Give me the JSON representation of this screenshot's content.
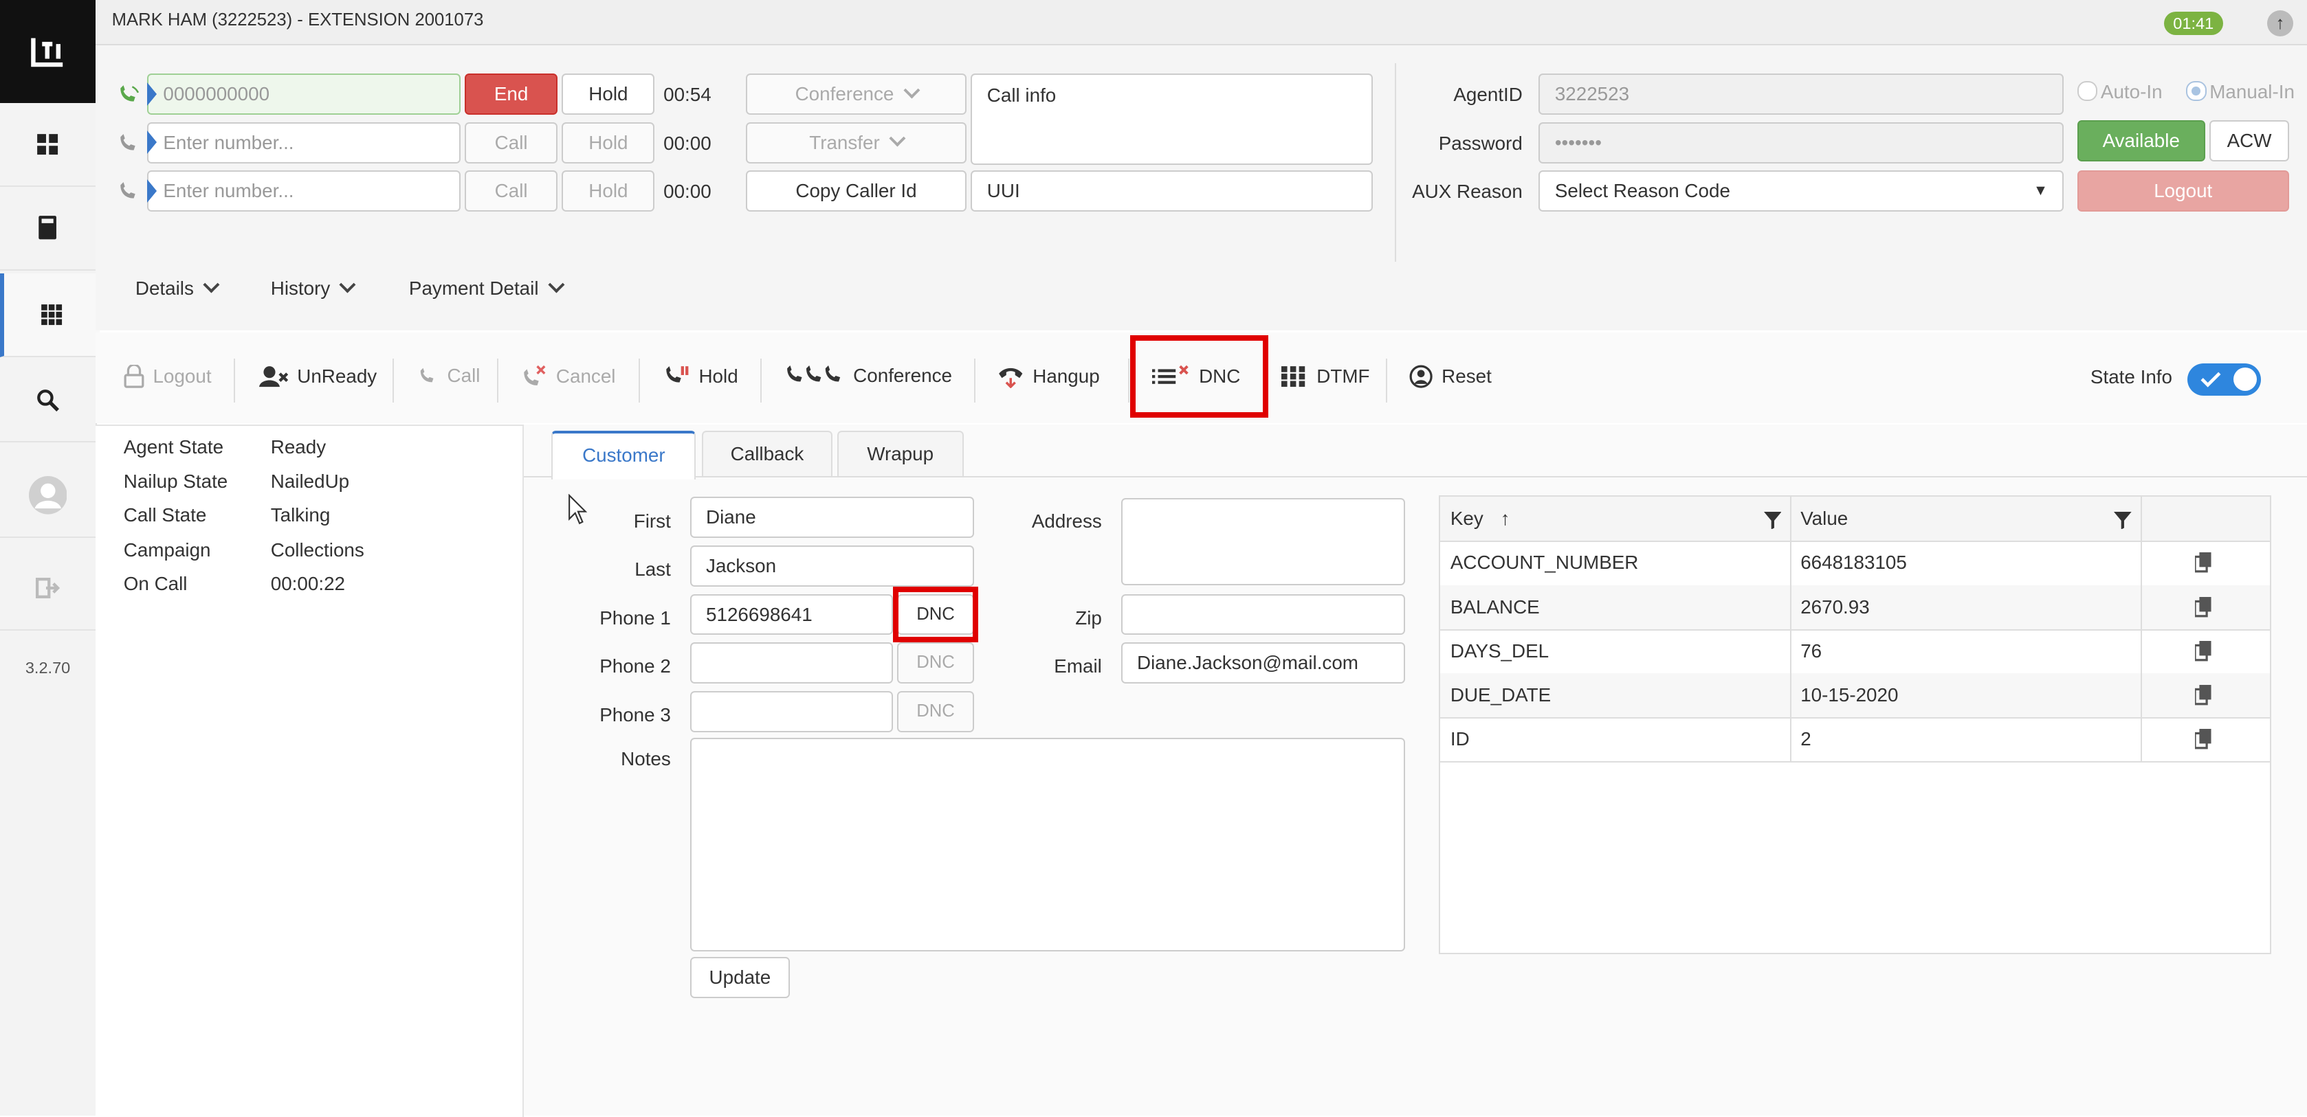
{
  "app": {
    "title": "MARK HAM (3222523) - EXTENSION 2001073",
    "timer": "01:41",
    "version": "3.2.70"
  },
  "lines": [
    {
      "number": "0000000000",
      "action": "End",
      "hold": "Hold",
      "time": "00:54"
    },
    {
      "placeholder": "Enter number...",
      "action": "Call",
      "hold": "Hold",
      "time": "00:00"
    },
    {
      "placeholder": "Enter number...",
      "action": "Call",
      "hold": "Hold",
      "time": "00:00"
    }
  ],
  "call_controls": {
    "conference": "Conference",
    "transfer": "Transfer",
    "copy_caller_id": "Copy Caller Id",
    "call_info_placeholder": "Call info",
    "uui_placeholder": "UUI"
  },
  "agent": {
    "agentid_label": "AgentID",
    "agentid_value": "3222523",
    "password_label": "Password",
    "password_value": "•••••••",
    "aux_label": "AUX Reason",
    "aux_value": "Select Reason Code",
    "auto_in": "Auto-In",
    "manual_in": "Manual-In",
    "available": "Available",
    "acw": "ACW",
    "logout": "Logout"
  },
  "menus": [
    "Details",
    "History",
    "Payment Detail"
  ],
  "toolbar": {
    "logout": "Logout",
    "unready": "UnReady",
    "call": "Call",
    "cancel": "Cancel",
    "hold": "Hold",
    "conference": "Conference",
    "hangup": "Hangup",
    "dnc": "DNC",
    "dtmf": "DTMF",
    "reset": "Reset",
    "state_info": "State Info",
    "highlight_color": "#e00000"
  },
  "state": [
    {
      "label": "Agent State",
      "value": "Ready"
    },
    {
      "label": "Nailup State",
      "value": "NailedUp"
    },
    {
      "label": "Call State",
      "value": "Talking"
    },
    {
      "label": "Campaign",
      "value": "Collections"
    },
    {
      "label": "On Call",
      "value": "00:00:22"
    }
  ],
  "tabs": [
    "Customer",
    "Callback",
    "Wrapup"
  ],
  "customer": {
    "first_label": "First",
    "first": "Diane",
    "last_label": "Last",
    "last": "Jackson",
    "phone1_label": "Phone 1",
    "phone1": "5126698641",
    "phone2_label": "Phone 2",
    "phone3_label": "Phone 3",
    "dnc": "DNC",
    "notes_label": "Notes",
    "address_label": "Address",
    "zip_label": "Zip",
    "email_label": "Email",
    "email": "Diane.Jackson@mail.com",
    "update": "Update"
  },
  "grid": {
    "key_header": "Key",
    "value_header": "Value",
    "rows": [
      {
        "key": "ACCOUNT_NUMBER",
        "value": "6648183105"
      },
      {
        "key": "BALANCE",
        "value": "2670.93"
      },
      {
        "key": "DAYS_DEL",
        "value": "76"
      },
      {
        "key": "DUE_DATE",
        "value": "10-15-2020"
      },
      {
        "key": "ID",
        "value": "2"
      }
    ]
  }
}
